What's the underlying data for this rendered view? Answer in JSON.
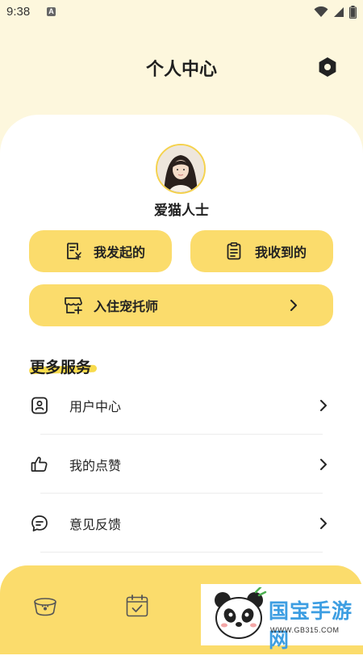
{
  "status_bar": {
    "time": "9:38",
    "notification_glyph": "A"
  },
  "header": {
    "title": "个人中心",
    "settings_icon": "hexagon-settings-icon"
  },
  "profile": {
    "username": "爱猫人士"
  },
  "actions": {
    "initiated": "我发起的",
    "received": "我收到的",
    "register_sitter": "入住宠托师"
  },
  "services": {
    "title": "更多服务",
    "items": [
      {
        "label": "用户中心",
        "icon": "user-card-icon"
      },
      {
        "label": "我的点赞",
        "icon": "thumbs-up-icon"
      },
      {
        "label": "意见反馈",
        "icon": "feedback-icon"
      }
    ]
  },
  "tab_bar": {
    "tabs": [
      "pet-bowl-icon",
      "calendar-check-icon"
    ]
  },
  "watermark": {
    "brand": "国宝手游网",
    "url": "WWW.GB315.COM"
  },
  "colors": {
    "accent": "#fbdc6c",
    "background": "#fdf7dd",
    "card": "#ffffff"
  }
}
